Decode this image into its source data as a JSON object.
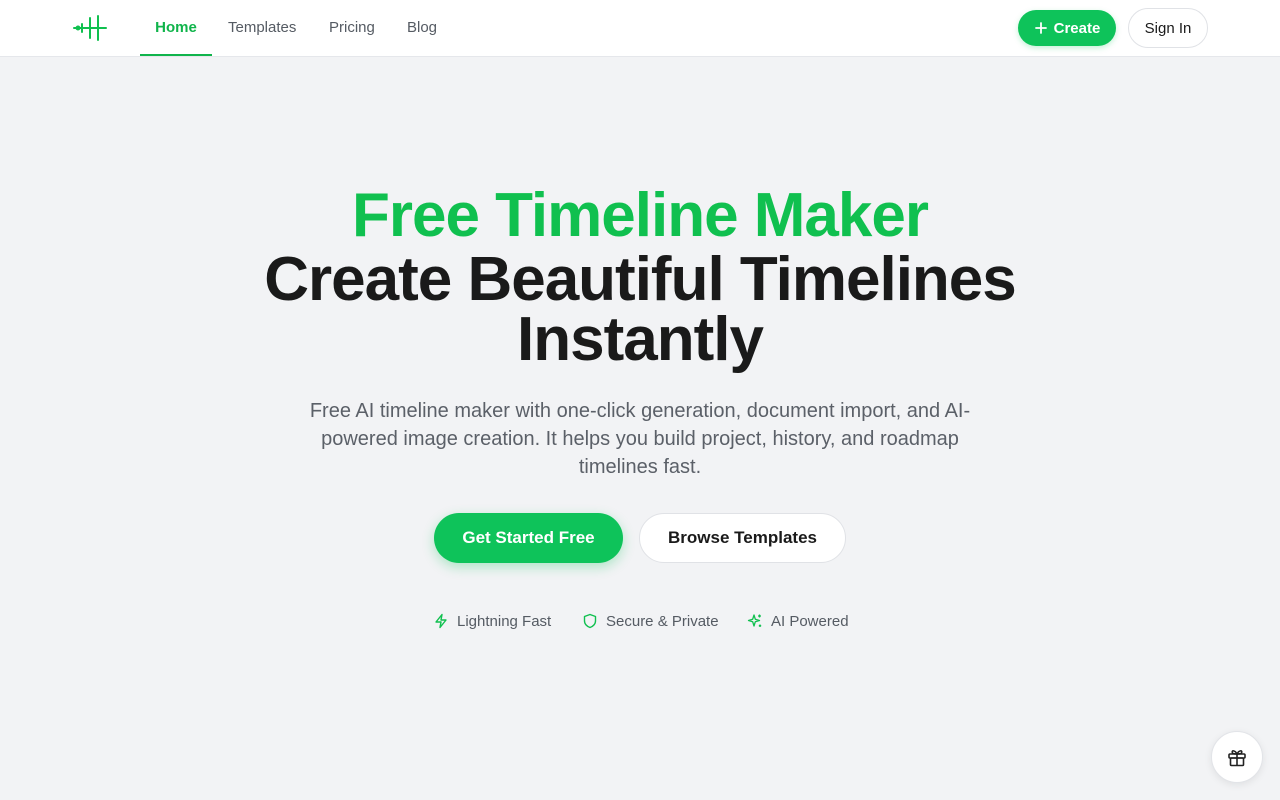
{
  "nav": {
    "tabs": [
      {
        "label": "Home",
        "active": true
      },
      {
        "label": "Templates",
        "active": false
      },
      {
        "label": "Pricing",
        "active": false
      },
      {
        "label": "Blog",
        "active": false
      }
    ],
    "create_label": "Create",
    "signin_label": "Sign In"
  },
  "hero": {
    "title_green": "Free Timeline Maker",
    "title_dark": "Create Beautiful Timelines Instantly",
    "subtitle": "Free AI timeline maker with one-click generation, document import, and AI-powered image creation. It helps you build project, history, and roadmap timelines fast.",
    "primary_cta": "Get Started Free",
    "secondary_cta": "Browse Templates"
  },
  "features": [
    {
      "label": "Lightning Fast",
      "icon": "lightning-icon"
    },
    {
      "label": "Secure & Private",
      "icon": "shield-icon"
    },
    {
      "label": "AI Powered",
      "icon": "sparkles-icon"
    }
  ],
  "colors": {
    "accent": "#0ec35a",
    "accent_text": "#10c04f",
    "background": "#f2f3f5",
    "heading": "#1a1a1a",
    "muted": "#5b6068"
  }
}
